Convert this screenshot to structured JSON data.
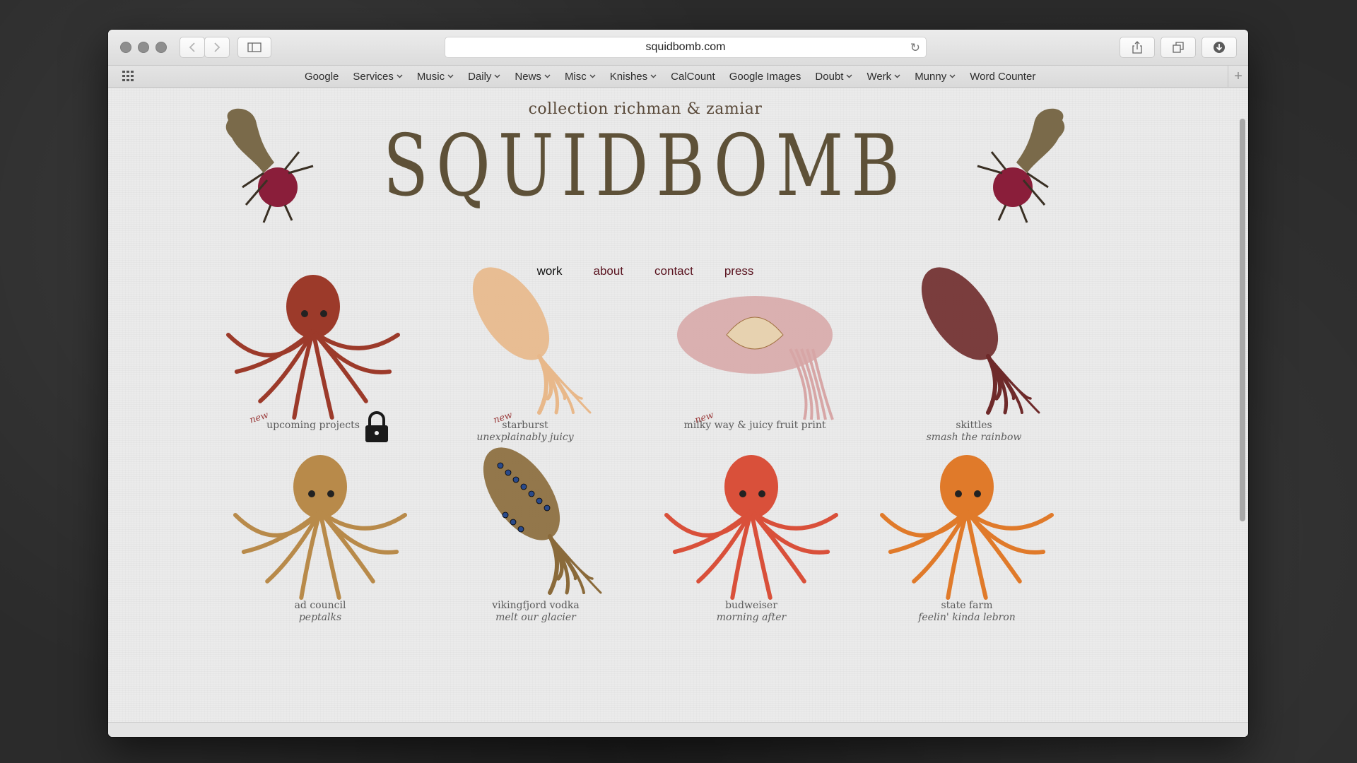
{
  "browser": {
    "url": "squidbomb.com",
    "bookmarks": [
      {
        "label": "Google",
        "dropdown": false
      },
      {
        "label": "Services",
        "dropdown": true
      },
      {
        "label": "Music",
        "dropdown": true
      },
      {
        "label": "Daily",
        "dropdown": true
      },
      {
        "label": "News",
        "dropdown": true
      },
      {
        "label": "Misc",
        "dropdown": true
      },
      {
        "label": "Knishes",
        "dropdown": true
      },
      {
        "label": "CalCount",
        "dropdown": false
      },
      {
        "label": "Google Images",
        "dropdown": false
      },
      {
        "label": "Doubt",
        "dropdown": true
      },
      {
        "label": "Werk",
        "dropdown": true
      },
      {
        "label": "Munny",
        "dropdown": true
      },
      {
        "label": "Word Counter",
        "dropdown": false
      }
    ]
  },
  "site": {
    "tagline": "collection richman & zamiar",
    "logo": "SQUIDBOMB",
    "nav": {
      "work": "work",
      "about": "about",
      "contact": "contact",
      "press": "press"
    },
    "new_label": "new",
    "tiles": [
      {
        "title": "upcoming projects",
        "subtitle": "",
        "is_new": true,
        "locked": true,
        "color": "#9c3a2a"
      },
      {
        "title": "starburst",
        "subtitle": "unexplainably juicy",
        "is_new": true,
        "locked": false,
        "color": "#e8b88a"
      },
      {
        "title": "milky way & juicy fruit print",
        "subtitle": "",
        "is_new": true,
        "locked": false,
        "color": "#d7a6a6"
      },
      {
        "title": "skittles",
        "subtitle": "smash the rainbow",
        "is_new": false,
        "locked": false,
        "color": "#6e2a2a"
      },
      {
        "title": "ad council",
        "subtitle": "peptalks",
        "is_new": false,
        "locked": false,
        "color": "#b88a4a"
      },
      {
        "title": "vikingfjord vodka",
        "subtitle": "melt our glacier",
        "is_new": false,
        "locked": false,
        "color": "#8a6a3a"
      },
      {
        "title": "budweiser",
        "subtitle": "morning after",
        "is_new": false,
        "locked": false,
        "color": "#d9503a"
      },
      {
        "title": "state farm",
        "subtitle": "feelin' kinda lebron",
        "is_new": false,
        "locked": false,
        "color": "#e07a2a"
      }
    ],
    "colors": {
      "logo": "#5e5138",
      "nav_link": "#5a1420",
      "mascot_body": "#7a6a4a",
      "mascot_head": "#8a1e3a"
    }
  }
}
